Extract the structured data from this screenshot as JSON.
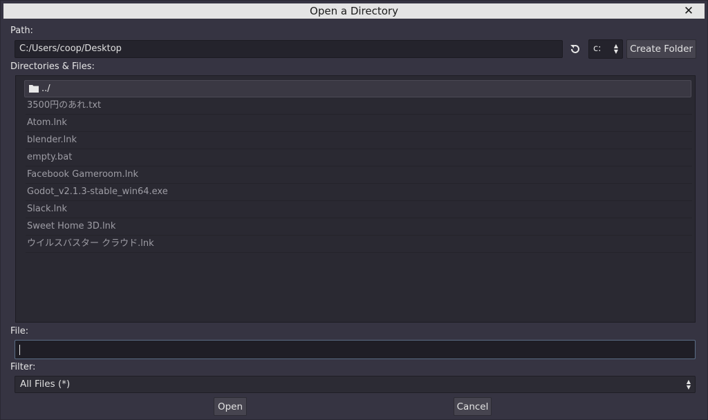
{
  "window": {
    "title": "Open a Directory",
    "close_glyph": "✕"
  },
  "path_section": {
    "label": "Path:",
    "value": "C:/Users/coop/Desktop",
    "drive": "c:",
    "create_folder_label": "Create Folder"
  },
  "files_section": {
    "label": "Directories & Files:",
    "items": [
      {
        "name": "../",
        "type": "folder"
      },
      {
        "name": "3500円のあれ.txt",
        "type": "file"
      },
      {
        "name": "Atom.lnk",
        "type": "file"
      },
      {
        "name": "blender.lnk",
        "type": "file"
      },
      {
        "name": "empty.bat",
        "type": "file"
      },
      {
        "name": "Facebook Gameroom.lnk",
        "type": "file"
      },
      {
        "name": "Godot_v2.1.3-stable_win64.exe",
        "type": "file"
      },
      {
        "name": "Slack.lnk",
        "type": "file"
      },
      {
        "name": "Sweet Home 3D.lnk",
        "type": "file"
      },
      {
        "name": "ウイルスバスター クラウド.lnk",
        "type": "file"
      }
    ]
  },
  "file_section": {
    "label": "File:",
    "value": ""
  },
  "filter_section": {
    "label": "Filter:",
    "selected": "All Files (*)"
  },
  "actions": {
    "open_label": "Open",
    "cancel_label": "Cancel"
  },
  "icons": {
    "refresh": "refresh-icon",
    "folder": "folder-icon",
    "close": "close-icon",
    "updown": "updown-arrows-icon"
  }
}
